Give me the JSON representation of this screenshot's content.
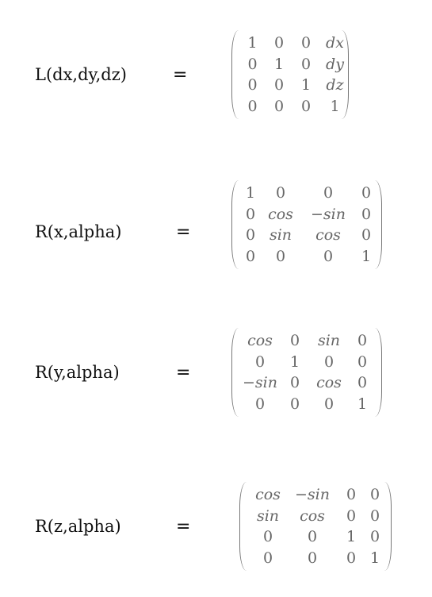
{
  "equations": [
    {
      "label": "L(dx,dy,dz)",
      "equals": "=",
      "rows": [
        [
          "1",
          "0",
          "0",
          "dx"
        ],
        [
          "0",
          "1",
          "0",
          "dy"
        ],
        [
          "0",
          "0",
          "1",
          "dz"
        ],
        [
          "0",
          "0",
          "0",
          "1"
        ]
      ]
    },
    {
      "label": "R(x,alpha)",
      "equals": "=",
      "rows": [
        [
          "1",
          "0",
          "0",
          "0"
        ],
        [
          "0",
          "cos",
          "−sin",
          "0"
        ],
        [
          "0",
          "sin",
          "cos",
          "0"
        ],
        [
          "0",
          "0",
          "0",
          "1"
        ]
      ]
    },
    {
      "label": "R(y,alpha)",
      "equals": "=",
      "rows": [
        [
          "cos",
          "0",
          "sin",
          "0"
        ],
        [
          "0",
          "1",
          "0",
          "0"
        ],
        [
          "−sin",
          "0",
          "cos",
          "0"
        ],
        [
          "0",
          "0",
          "0",
          "1"
        ]
      ]
    },
    {
      "label": "R(z,alpha)",
      "equals": "=",
      "rows": [
        [
          "cos",
          "−sin",
          "0",
          "0"
        ],
        [
          "sin",
          "cos",
          "0",
          "0"
        ],
        [
          "0",
          "0",
          "1",
          "0"
        ],
        [
          "0",
          "0",
          "0",
          "1"
        ]
      ]
    }
  ]
}
